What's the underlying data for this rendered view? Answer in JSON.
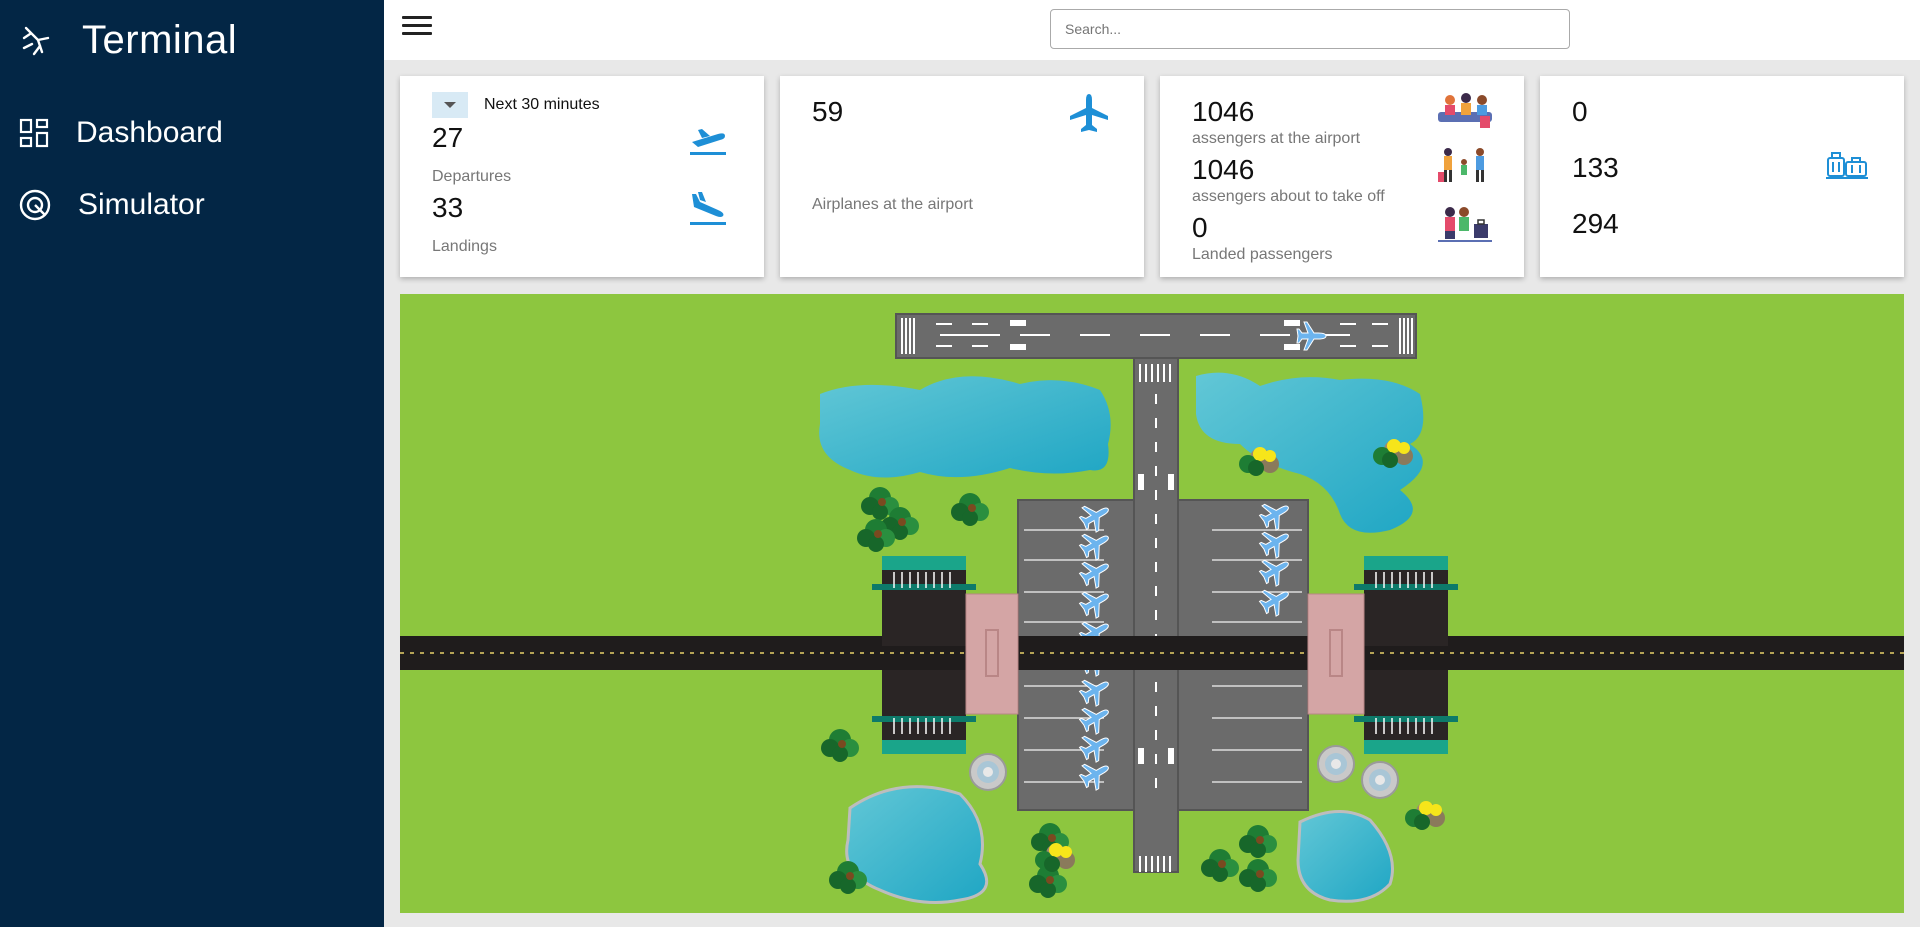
{
  "app": {
    "title": "Terminal"
  },
  "sidebar": {
    "items": [
      {
        "label": "Dashboard",
        "icon": "dashboard-icon"
      },
      {
        "label": "Simulator",
        "icon": "simulator-icon"
      }
    ]
  },
  "topbar": {
    "search_placeholder": "Search..."
  },
  "cards": {
    "flights": {
      "filter_label": "Next 30 minutes",
      "departures_value": "27",
      "departures_label": "Departures",
      "landings_value": "33",
      "landings_label": "Landings"
    },
    "airplanes": {
      "value": "59",
      "label": "Airplanes at the airport"
    },
    "passengers": {
      "at_airport_value": "1046",
      "at_airport_label": "assengers at the airport",
      "takeoff_value": "1046",
      "takeoff_label": "assengers about to take off",
      "landed_value": "0",
      "landed_label": "Landed passengers"
    },
    "luggage": {
      "value_1": "0",
      "value_2": "133",
      "value_3": "294"
    }
  },
  "colors": {
    "sidebar_bg": "#032645",
    "accent": "#1e8fd6",
    "grass": "#8dc63f",
    "runway": "#6b6b6b",
    "water": "#3fb7cf"
  }
}
